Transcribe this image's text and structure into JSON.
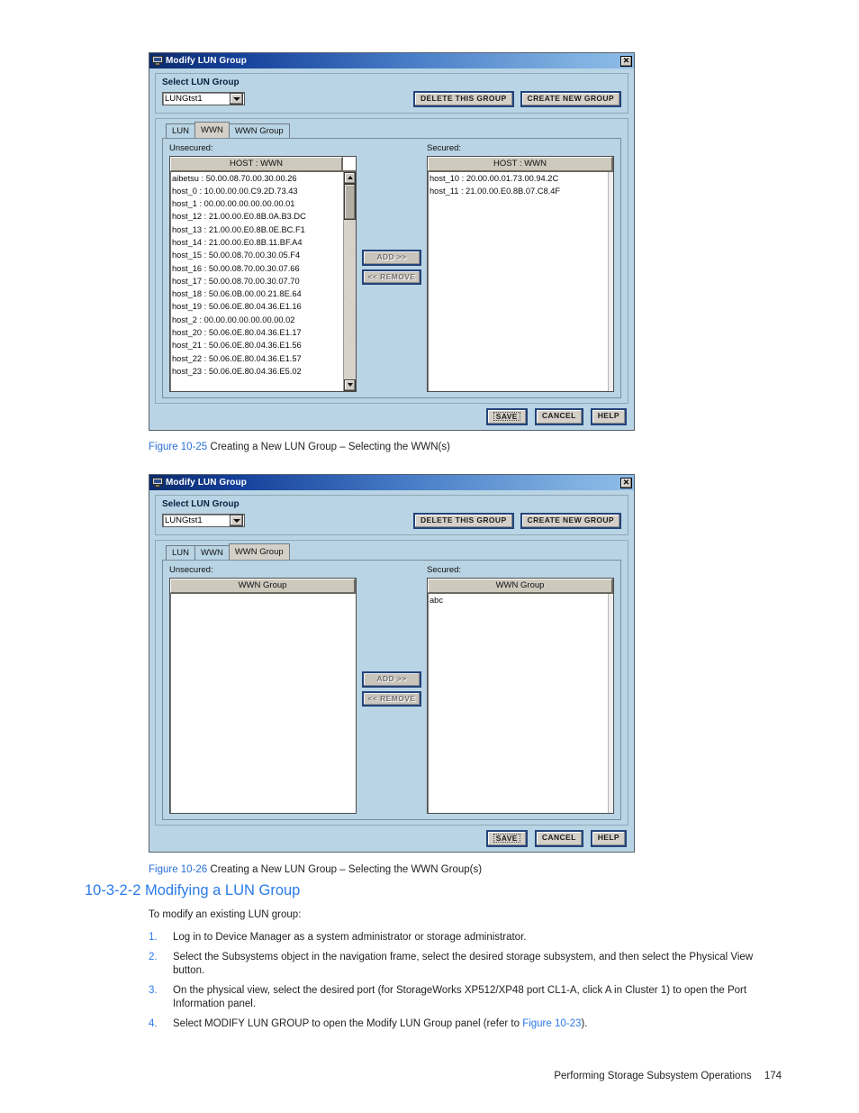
{
  "dialog1": {
    "title": "Modify LUN Group",
    "close_label": "✕",
    "select_panel": {
      "heading": "Select LUN Group",
      "combo_value": "LUNGtst1",
      "delete_button": "DELETE THIS GROUP",
      "create_button": "CREATE NEW GROUP"
    },
    "tabs": [
      {
        "label": "LUN",
        "active": false
      },
      {
        "label": "WWN",
        "active": true
      },
      {
        "label": "WWN Group",
        "active": false
      }
    ],
    "unsecured_label": "Unsecured:",
    "secured_label": "Secured:",
    "unsecured_header": "HOST : WWN",
    "secured_header": "HOST : WWN",
    "unsecured_rows": [
      "aibetsu : 50.00.08.70.00.30.00.26",
      "host_0 : 10.00.00.00.C9.2D.73.43",
      "host_1 : 00.00.00.00.00.00.00.01",
      "host_12 : 21.00.00.E0.8B.0A.B3.DC",
      "host_13 : 21.00.00.E0.8B.0E.BC.F1",
      "host_14 : 21.00.00.E0.8B.11.BF.A4",
      "host_15 : 50.00.08.70.00.30.05.F4",
      "host_16 : 50.00.08.70.00.30.07.66",
      "host_17 : 50.00.08.70.00.30.07.70",
      "host_18 : 50.06.0B.00.00.21.8E.64",
      "host_19 : 50.06.0E.80.04.36.E1.16",
      "host_2 : 00.00.00.00.00.00.00.02",
      "host_20 : 50.06.0E.80.04.36.E1.17",
      "host_21 : 50.06.0E.80.04.36.E1.56",
      "host_22 : 50.06.0E.80.04.36.E1.57",
      "host_23 : 50.06.0E.80.04.36.E5.02"
    ],
    "secured_rows": [
      "host_10 : 20.00.00.01.73.00.94.2C",
      "host_11 : 21.00.00.E0.8B.07.C8.4F"
    ],
    "add_button": "ADD >>",
    "remove_button": "<< REMOVE",
    "save_button": "SAVE",
    "cancel_button": "CANCEL",
    "help_button": "HELP"
  },
  "dialog2": {
    "title": "Modify LUN Group",
    "close_label": "✕",
    "select_panel": {
      "heading": "Select LUN Group",
      "combo_value": "LUNGtst1",
      "delete_button": "DELETE THIS GROUP",
      "create_button": "CREATE NEW GROUP"
    },
    "tabs": [
      {
        "label": "LUN",
        "active": false
      },
      {
        "label": "WWN",
        "active": false
      },
      {
        "label": "WWN Group",
        "active": true
      }
    ],
    "unsecured_label": "Unsecured:",
    "secured_label": "Secured:",
    "unsecured_header": "WWN Group",
    "secured_header": "WWN Group",
    "unsecured_rows": [],
    "secured_rows": [
      "abc"
    ],
    "add_button": "ADD >>",
    "remove_button": "<< REMOVE",
    "save_button": "SAVE",
    "cancel_button": "CANCEL",
    "help_button": "HELP"
  },
  "captions": {
    "fig25_ref": "Figure 10-25",
    "fig25_text": "Creating a New LUN Group – Selecting the WWN(s)",
    "fig26_ref": "Figure 10-26",
    "fig26_text": "Creating a New LUN Group – Selecting the WWN Group(s)"
  },
  "section": {
    "heading": "10-3-2-2 Modifying a LUN Group",
    "intro": "To modify an existing LUN group:",
    "steps": [
      {
        "num": "1.",
        "text": "Log in to Device Manager as a system administrator or storage administrator."
      },
      {
        "num": "2.",
        "text": "Select the Subsystems object in the navigation frame, select the desired storage subsystem, and then select the Physical View button."
      },
      {
        "num": "3.",
        "text": "On the physical view, select the desired port (for StorageWorks XP512/XP48 port CL1-A, click A in Cluster 1) to open the Port Information panel."
      },
      {
        "num": "4a.",
        "text": "Select MODIFY LUN GROUP to open the Modify LUN Group panel (refer to "
      },
      {
        "num": "4b_ref",
        "text": "Figure 10-23"
      },
      {
        "num": "4c.",
        "text": ")."
      }
    ],
    "step4_prefix": "Select MODIFY LUN GROUP to open the Modify LUN Group panel (refer to ",
    "step4_ref": "Figure 10-23",
    "step4_suffix": ")."
  },
  "footer": {
    "text": "Performing Storage Subsystem Operations",
    "page": "174"
  }
}
